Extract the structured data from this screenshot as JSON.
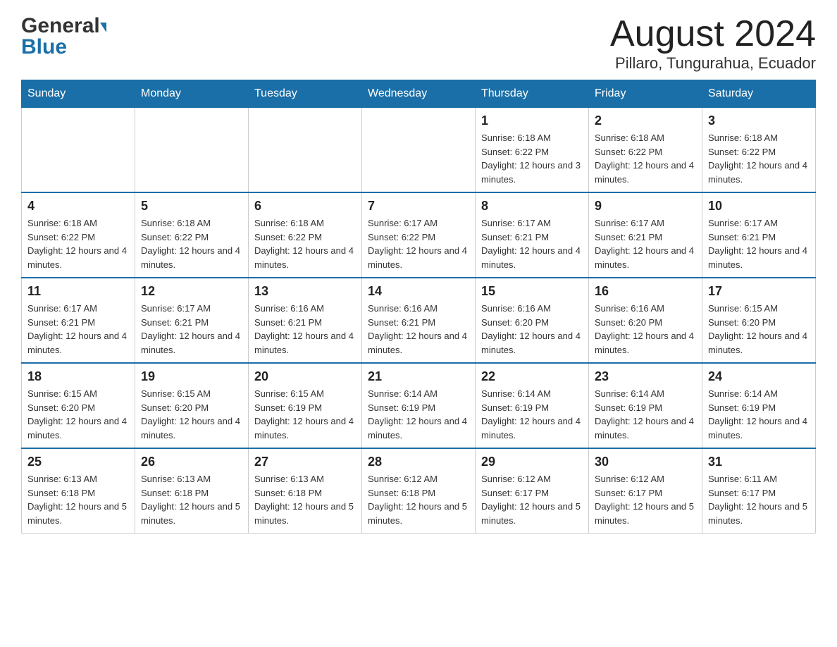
{
  "header": {
    "logo_general": "General",
    "logo_blue": "Blue",
    "month_title": "August 2024",
    "location": "Pillaro, Tungurahua, Ecuador"
  },
  "days_of_week": [
    "Sunday",
    "Monday",
    "Tuesday",
    "Wednesday",
    "Thursday",
    "Friday",
    "Saturday"
  ],
  "weeks": [
    [
      {
        "day": "",
        "info": ""
      },
      {
        "day": "",
        "info": ""
      },
      {
        "day": "",
        "info": ""
      },
      {
        "day": "",
        "info": ""
      },
      {
        "day": "1",
        "info": "Sunrise: 6:18 AM\nSunset: 6:22 PM\nDaylight: 12 hours and 3 minutes."
      },
      {
        "day": "2",
        "info": "Sunrise: 6:18 AM\nSunset: 6:22 PM\nDaylight: 12 hours and 4 minutes."
      },
      {
        "day": "3",
        "info": "Sunrise: 6:18 AM\nSunset: 6:22 PM\nDaylight: 12 hours and 4 minutes."
      }
    ],
    [
      {
        "day": "4",
        "info": "Sunrise: 6:18 AM\nSunset: 6:22 PM\nDaylight: 12 hours and 4 minutes."
      },
      {
        "day": "5",
        "info": "Sunrise: 6:18 AM\nSunset: 6:22 PM\nDaylight: 12 hours and 4 minutes."
      },
      {
        "day": "6",
        "info": "Sunrise: 6:18 AM\nSunset: 6:22 PM\nDaylight: 12 hours and 4 minutes."
      },
      {
        "day": "7",
        "info": "Sunrise: 6:17 AM\nSunset: 6:22 PM\nDaylight: 12 hours and 4 minutes."
      },
      {
        "day": "8",
        "info": "Sunrise: 6:17 AM\nSunset: 6:21 PM\nDaylight: 12 hours and 4 minutes."
      },
      {
        "day": "9",
        "info": "Sunrise: 6:17 AM\nSunset: 6:21 PM\nDaylight: 12 hours and 4 minutes."
      },
      {
        "day": "10",
        "info": "Sunrise: 6:17 AM\nSunset: 6:21 PM\nDaylight: 12 hours and 4 minutes."
      }
    ],
    [
      {
        "day": "11",
        "info": "Sunrise: 6:17 AM\nSunset: 6:21 PM\nDaylight: 12 hours and 4 minutes."
      },
      {
        "day": "12",
        "info": "Sunrise: 6:17 AM\nSunset: 6:21 PM\nDaylight: 12 hours and 4 minutes."
      },
      {
        "day": "13",
        "info": "Sunrise: 6:16 AM\nSunset: 6:21 PM\nDaylight: 12 hours and 4 minutes."
      },
      {
        "day": "14",
        "info": "Sunrise: 6:16 AM\nSunset: 6:21 PM\nDaylight: 12 hours and 4 minutes."
      },
      {
        "day": "15",
        "info": "Sunrise: 6:16 AM\nSunset: 6:20 PM\nDaylight: 12 hours and 4 minutes."
      },
      {
        "day": "16",
        "info": "Sunrise: 6:16 AM\nSunset: 6:20 PM\nDaylight: 12 hours and 4 minutes."
      },
      {
        "day": "17",
        "info": "Sunrise: 6:15 AM\nSunset: 6:20 PM\nDaylight: 12 hours and 4 minutes."
      }
    ],
    [
      {
        "day": "18",
        "info": "Sunrise: 6:15 AM\nSunset: 6:20 PM\nDaylight: 12 hours and 4 minutes."
      },
      {
        "day": "19",
        "info": "Sunrise: 6:15 AM\nSunset: 6:20 PM\nDaylight: 12 hours and 4 minutes."
      },
      {
        "day": "20",
        "info": "Sunrise: 6:15 AM\nSunset: 6:19 PM\nDaylight: 12 hours and 4 minutes."
      },
      {
        "day": "21",
        "info": "Sunrise: 6:14 AM\nSunset: 6:19 PM\nDaylight: 12 hours and 4 minutes."
      },
      {
        "day": "22",
        "info": "Sunrise: 6:14 AM\nSunset: 6:19 PM\nDaylight: 12 hours and 4 minutes."
      },
      {
        "day": "23",
        "info": "Sunrise: 6:14 AM\nSunset: 6:19 PM\nDaylight: 12 hours and 4 minutes."
      },
      {
        "day": "24",
        "info": "Sunrise: 6:14 AM\nSunset: 6:19 PM\nDaylight: 12 hours and 4 minutes."
      }
    ],
    [
      {
        "day": "25",
        "info": "Sunrise: 6:13 AM\nSunset: 6:18 PM\nDaylight: 12 hours and 5 minutes."
      },
      {
        "day": "26",
        "info": "Sunrise: 6:13 AM\nSunset: 6:18 PM\nDaylight: 12 hours and 5 minutes."
      },
      {
        "day": "27",
        "info": "Sunrise: 6:13 AM\nSunset: 6:18 PM\nDaylight: 12 hours and 5 minutes."
      },
      {
        "day": "28",
        "info": "Sunrise: 6:12 AM\nSunset: 6:18 PM\nDaylight: 12 hours and 5 minutes."
      },
      {
        "day": "29",
        "info": "Sunrise: 6:12 AM\nSunset: 6:17 PM\nDaylight: 12 hours and 5 minutes."
      },
      {
        "day": "30",
        "info": "Sunrise: 6:12 AM\nSunset: 6:17 PM\nDaylight: 12 hours and 5 minutes."
      },
      {
        "day": "31",
        "info": "Sunrise: 6:11 AM\nSunset: 6:17 PM\nDaylight: 12 hours and 5 minutes."
      }
    ]
  ]
}
